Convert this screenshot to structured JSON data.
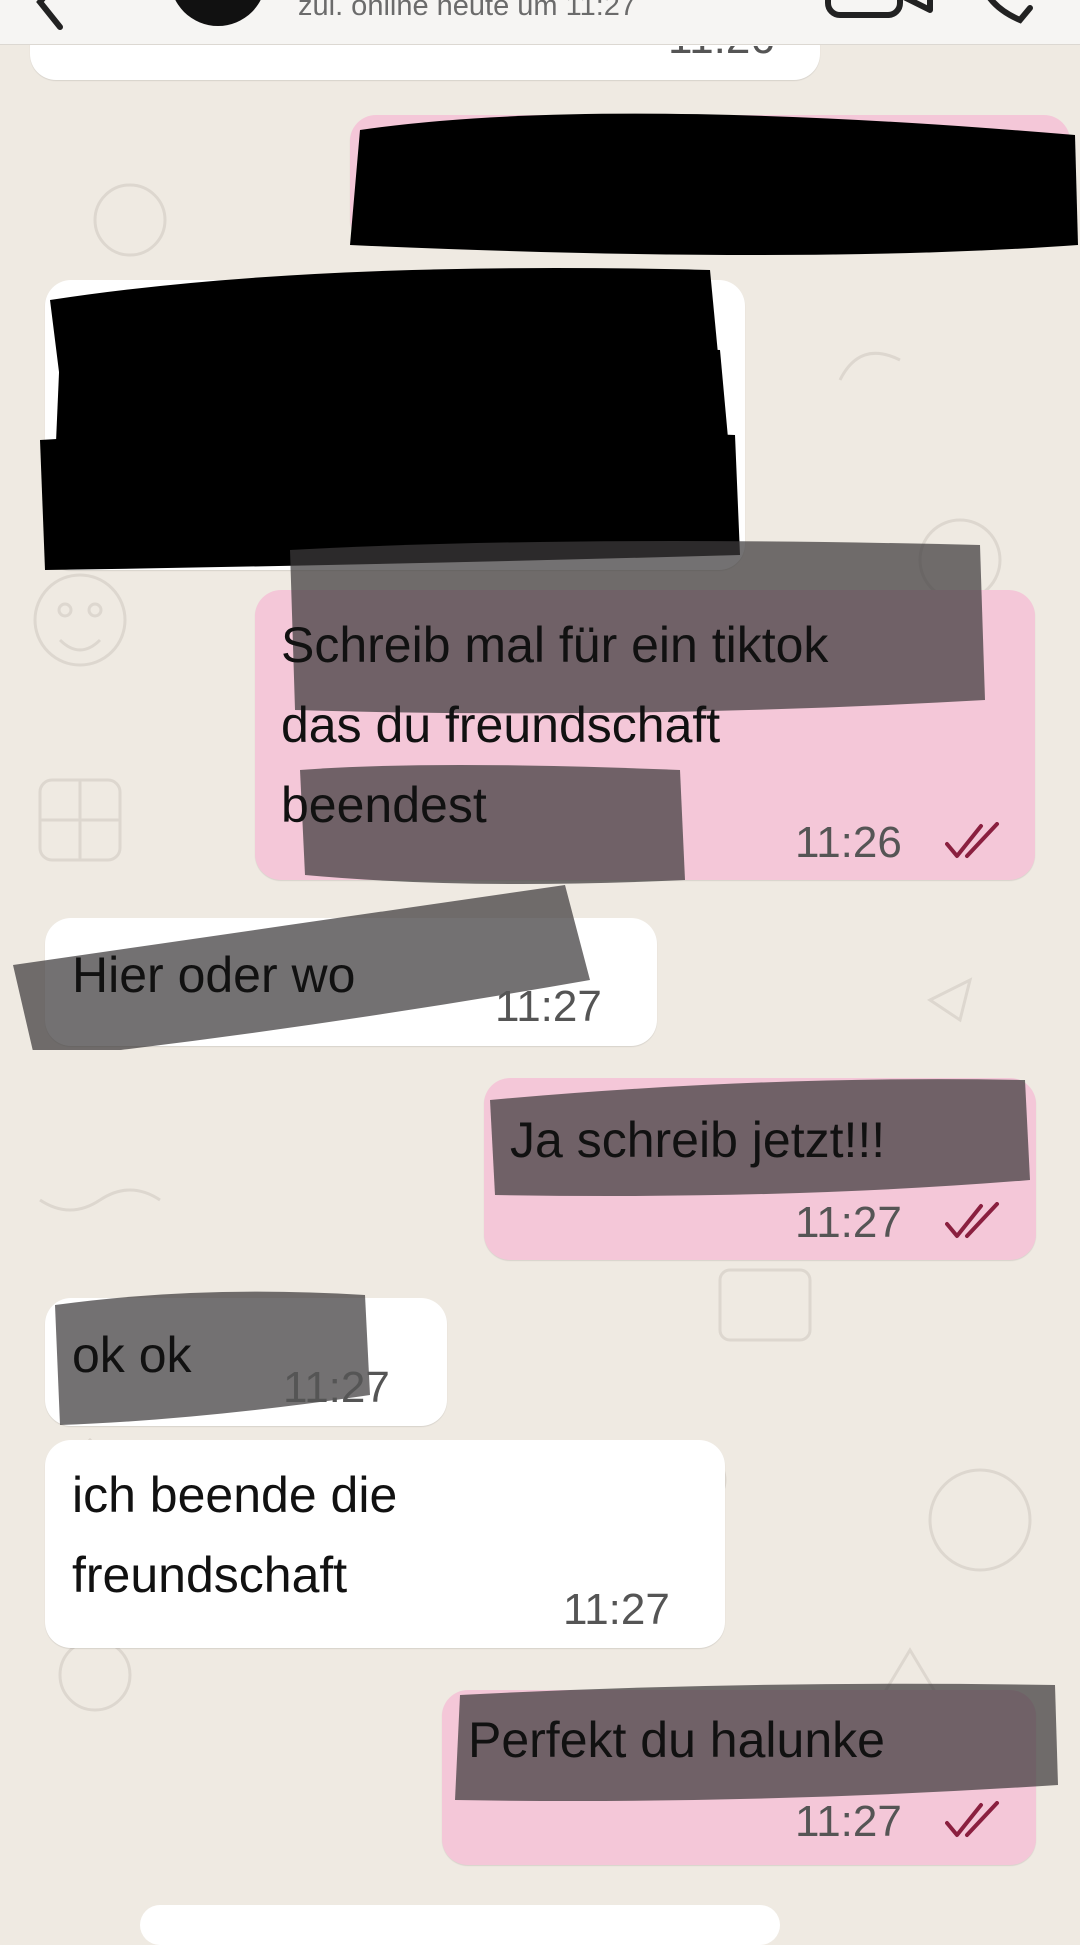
{
  "header": {
    "last_seen": "zul. online heute um 11:27",
    "contact_avatar": "avatar-redacted"
  },
  "colors": {
    "background": "#efeae2",
    "incoming_bubble": "#ffffff",
    "outgoing_bubble": "#f4c7d8",
    "read_ticks": "#8a1f3f"
  },
  "messages": [
    {
      "direction": "in",
      "text": "",
      "time": "11:26",
      "redacted": true
    },
    {
      "direction": "out",
      "text": "",
      "time": "",
      "redacted": true
    },
    {
      "direction": "in",
      "text": "",
      "time": "",
      "redacted": true
    },
    {
      "direction": "out",
      "text": "Schreib mal für ein tiktok\ndas du freundschaft\nbeendest",
      "time": "11:26",
      "status": "read"
    },
    {
      "direction": "in",
      "text": "Hier oder wo",
      "time": "11:27"
    },
    {
      "direction": "out",
      "text": "Ja schreib jetzt!!!",
      "time": "11:27",
      "status": "read"
    },
    {
      "direction": "in",
      "text": "ok ok",
      "time": "11:27"
    },
    {
      "direction": "in",
      "text": "ich beende die\nfreundschaft",
      "time": "11:27"
    },
    {
      "direction": "out",
      "text": "Perfekt du halunke",
      "time": "11:27",
      "status": "read"
    }
  ]
}
